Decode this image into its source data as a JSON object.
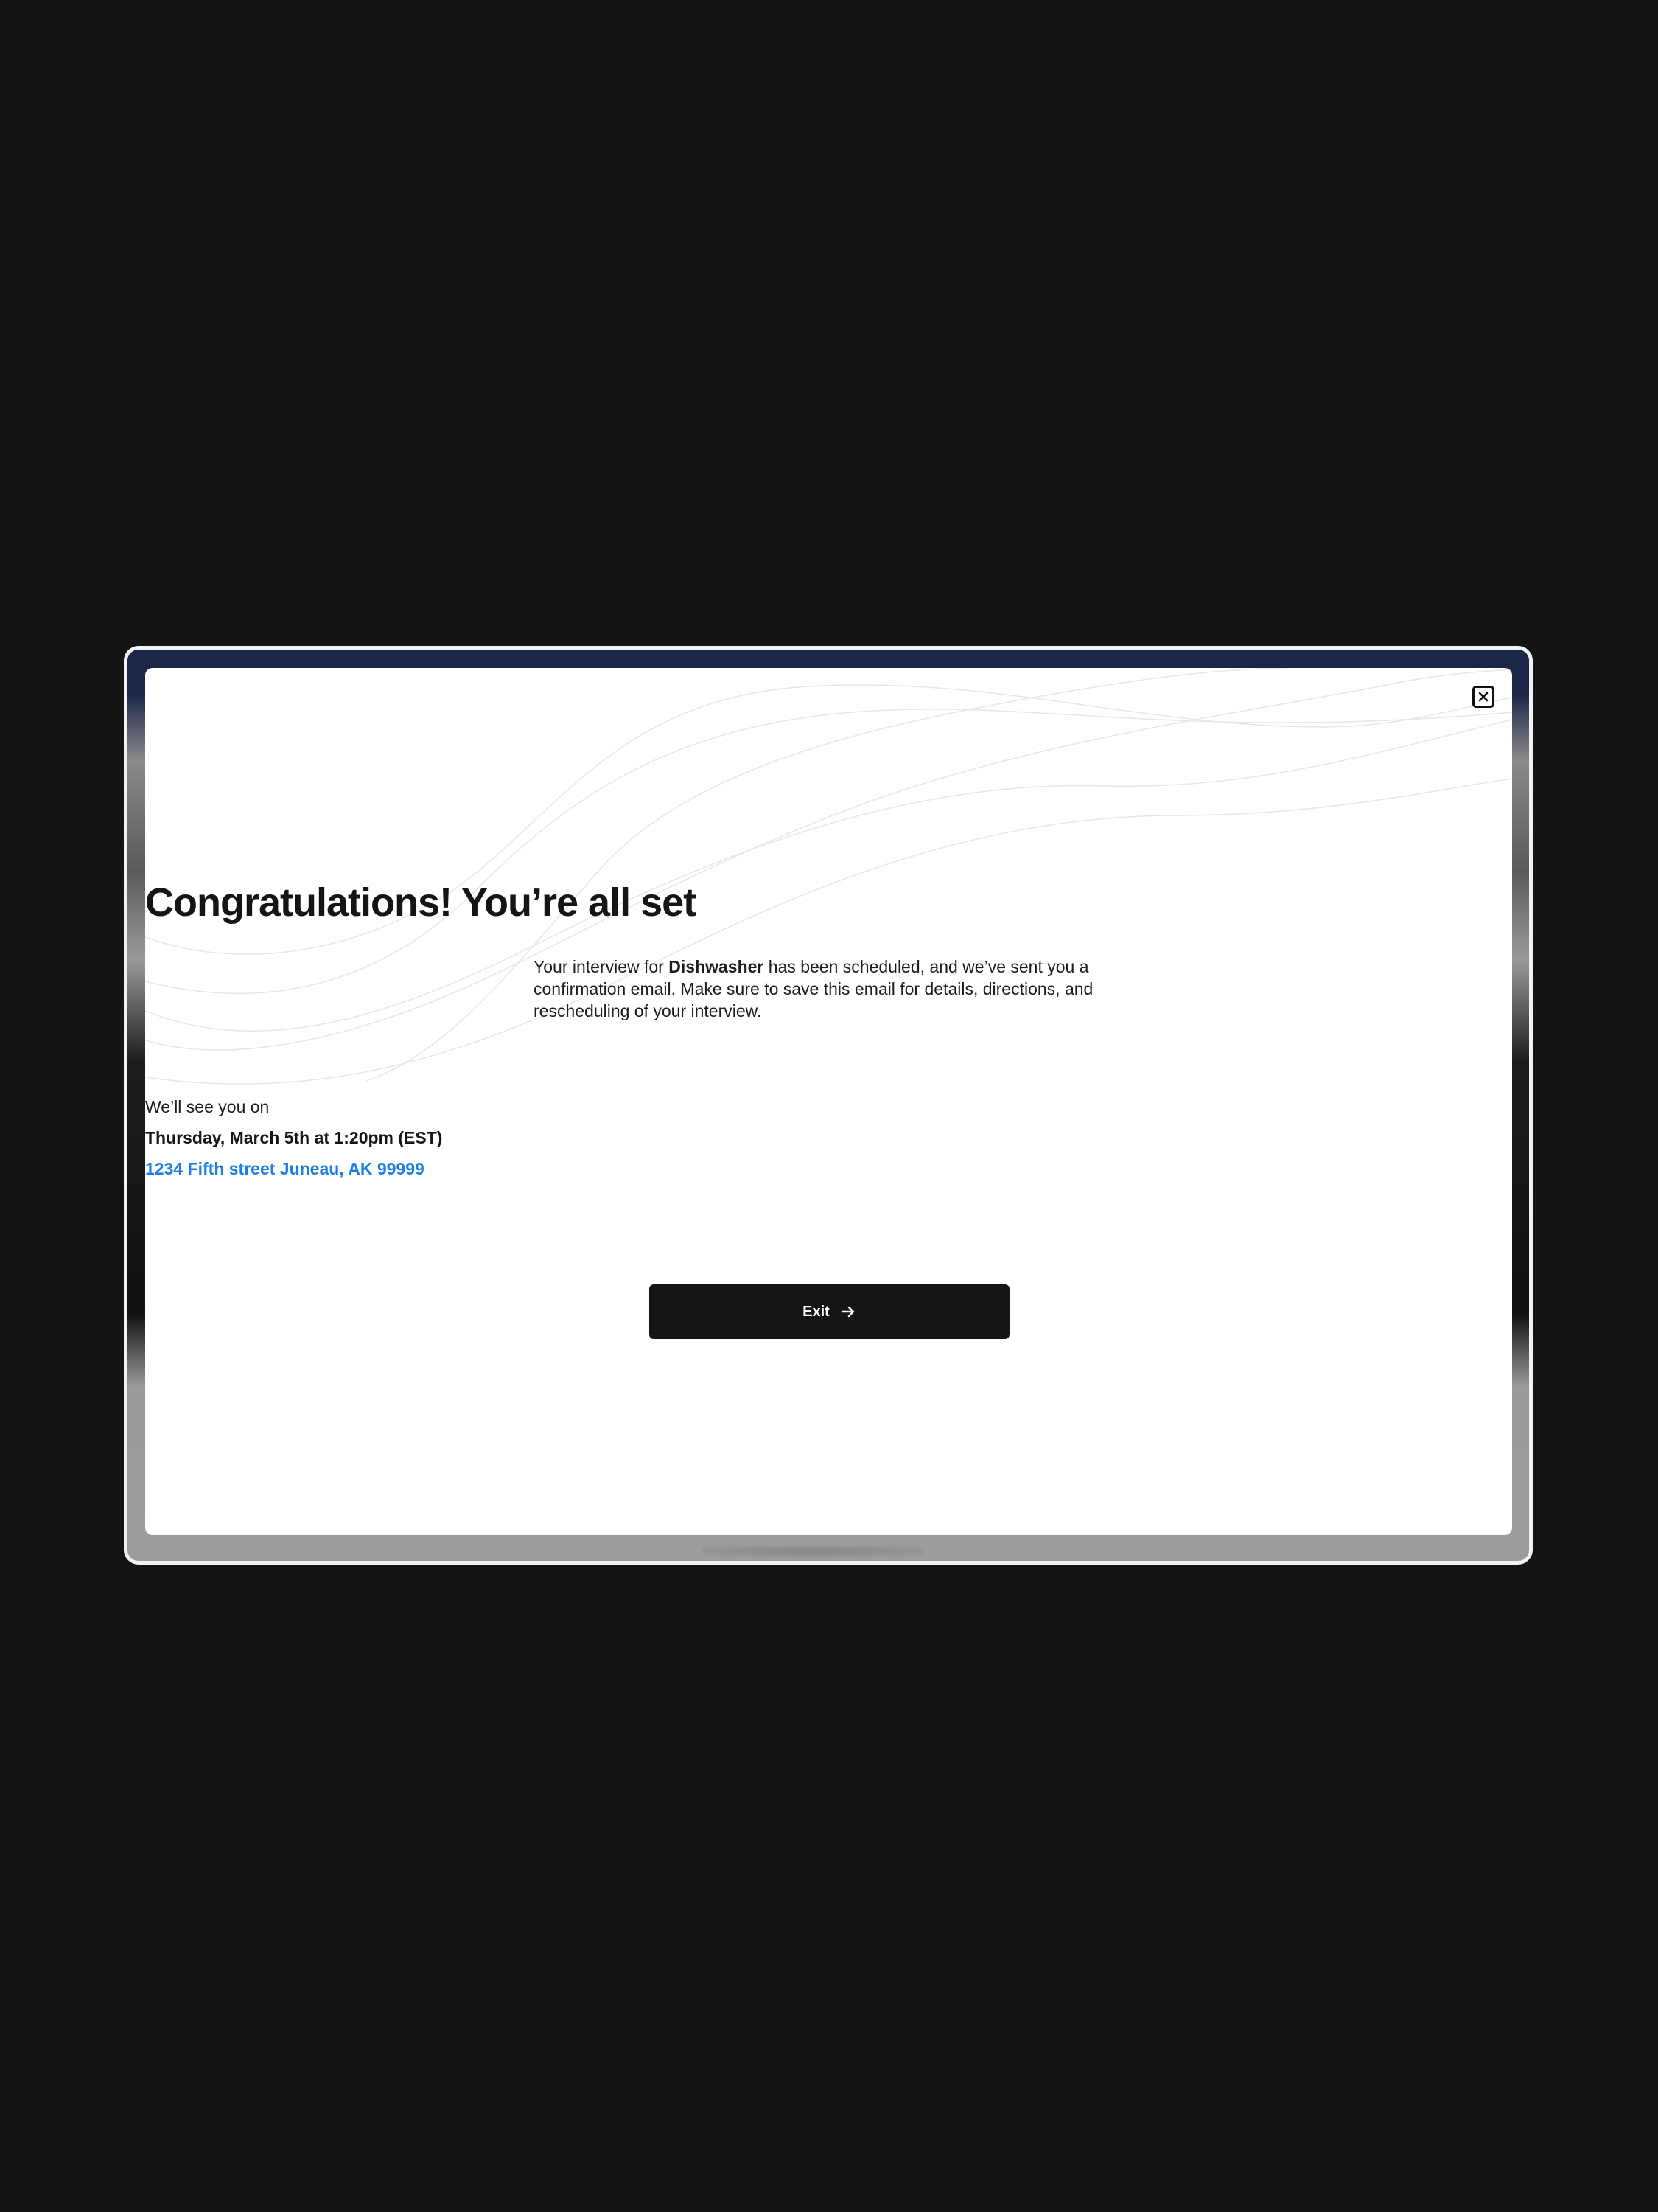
{
  "modal": {
    "title": "Congratulations! You’re all set",
    "description": {
      "prefix": "Your interview for ",
      "job_title": "Dishwasher",
      "suffix": " has been scheduled, and we’ve sent you a confirmation email. Make sure to save this email for details, directions, and rescheduling of your interview."
    },
    "see_you_label": "We’ll see you on",
    "date_time": "Thursday, March 5th at 1:20pm (EST)",
    "address": "1234 Fifth street Juneau, AK 99999",
    "exit_label": "Exit",
    "close_icon": "close-icon",
    "exit_icon": "arrow-right-icon"
  },
  "colors": {
    "background": "#141414",
    "card": "#ffffff",
    "text": "#151515",
    "link": "#1d7fe0",
    "button": "#151515"
  }
}
